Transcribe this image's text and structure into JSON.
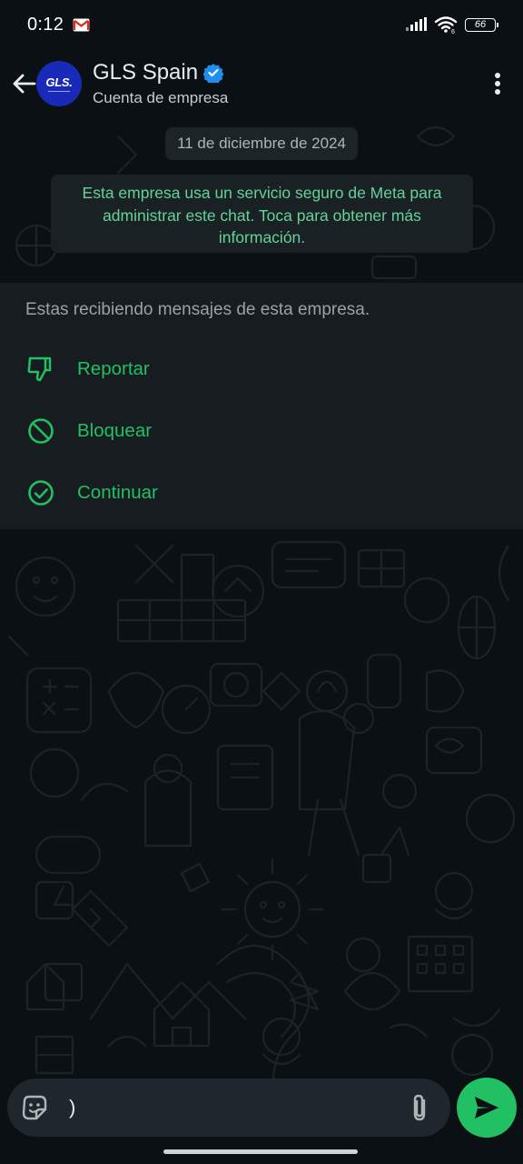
{
  "status_bar": {
    "time": "0:12",
    "battery": "66",
    "notification_icon": "gmail-icon",
    "signal_icon": "cell-signal-icon",
    "wifi_icon": "wifi-icon"
  },
  "header": {
    "contact_name": "GLS Spain",
    "subtitle": "Cuenta de empresa",
    "avatar_text": "GLS.",
    "verified_icon": "verified-badge-icon",
    "back_icon": "back-arrow-icon",
    "menu_icon": "more-vert-icon"
  },
  "chat": {
    "date_chip": "11 de diciembre de 2024",
    "security_notice": "Esta empresa usa un servicio seguro de Meta para administrar este chat. Toca para obtener más información."
  },
  "business_panel": {
    "message": "Estas recibiendo mensajes de esta empresa.",
    "actions": [
      {
        "label": "Reportar",
        "icon": "thumbs-down-icon"
      },
      {
        "label": "Bloquear",
        "icon": "block-icon"
      },
      {
        "label": "Continuar",
        "icon": "check-circle-icon"
      }
    ]
  },
  "composer": {
    "input_value": ")",
    "sticker_icon": "sticker-icon",
    "attach_icon": "paperclip-icon",
    "send_icon": "send-icon"
  },
  "colors": {
    "background": "#0b1014",
    "accent": "#21c063",
    "notice_text": "#66d199",
    "panel": "#161c20",
    "avatar": "#1a2ab8",
    "verified": "#1f8ef1"
  }
}
